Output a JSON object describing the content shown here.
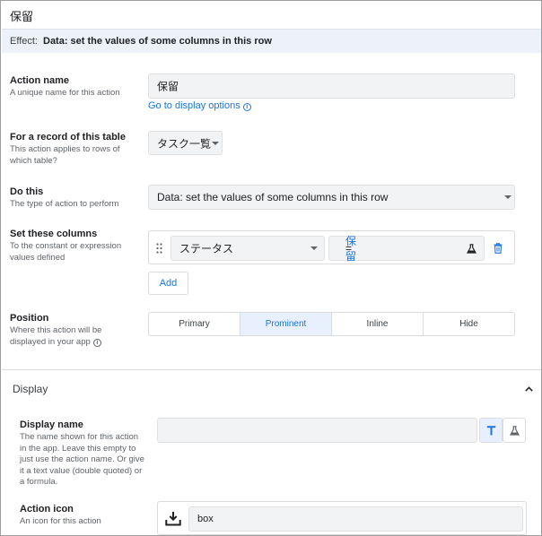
{
  "header": {
    "title": "保留"
  },
  "effect": {
    "label": "Effect:",
    "value": "Data: set the values of some columns in this row"
  },
  "action_name": {
    "label": "Action name",
    "description": "A unique name for this action",
    "value": "保留",
    "link": "Go to display options"
  },
  "table": {
    "label": "For a record of this table",
    "description": "This action applies to rows of which table?",
    "value": "タスク一覧"
  },
  "do_this": {
    "label": "Do this",
    "description": "The type of action to perform",
    "value": "Data: set the values of some columns in this row"
  },
  "set_columns": {
    "label": "Set these columns",
    "description": "To the constant or expression values defined",
    "column": "ステータス",
    "expression_prefix": "=",
    "expression": "保留",
    "add_label": "Add"
  },
  "position": {
    "label": "Position",
    "description": "Where this action will be displayed in your app",
    "options": [
      "Primary",
      "Prominent",
      "Inline",
      "Hide"
    ],
    "selected": "Prominent"
  },
  "display_section": {
    "title": "Display"
  },
  "display_name": {
    "label": "Display name",
    "description": "The name shown for this action in the app. Leave this empty to just use the action name. Or give it a text value (double quoted) or a formula.",
    "value": ""
  },
  "action_icon": {
    "label": "Action icon",
    "description": "An icon for this action",
    "value": "box"
  },
  "colors": {
    "accent": "#1a73e8",
    "effect_bg": "#edf2fa",
    "input_bg": "#f1f3f4"
  }
}
